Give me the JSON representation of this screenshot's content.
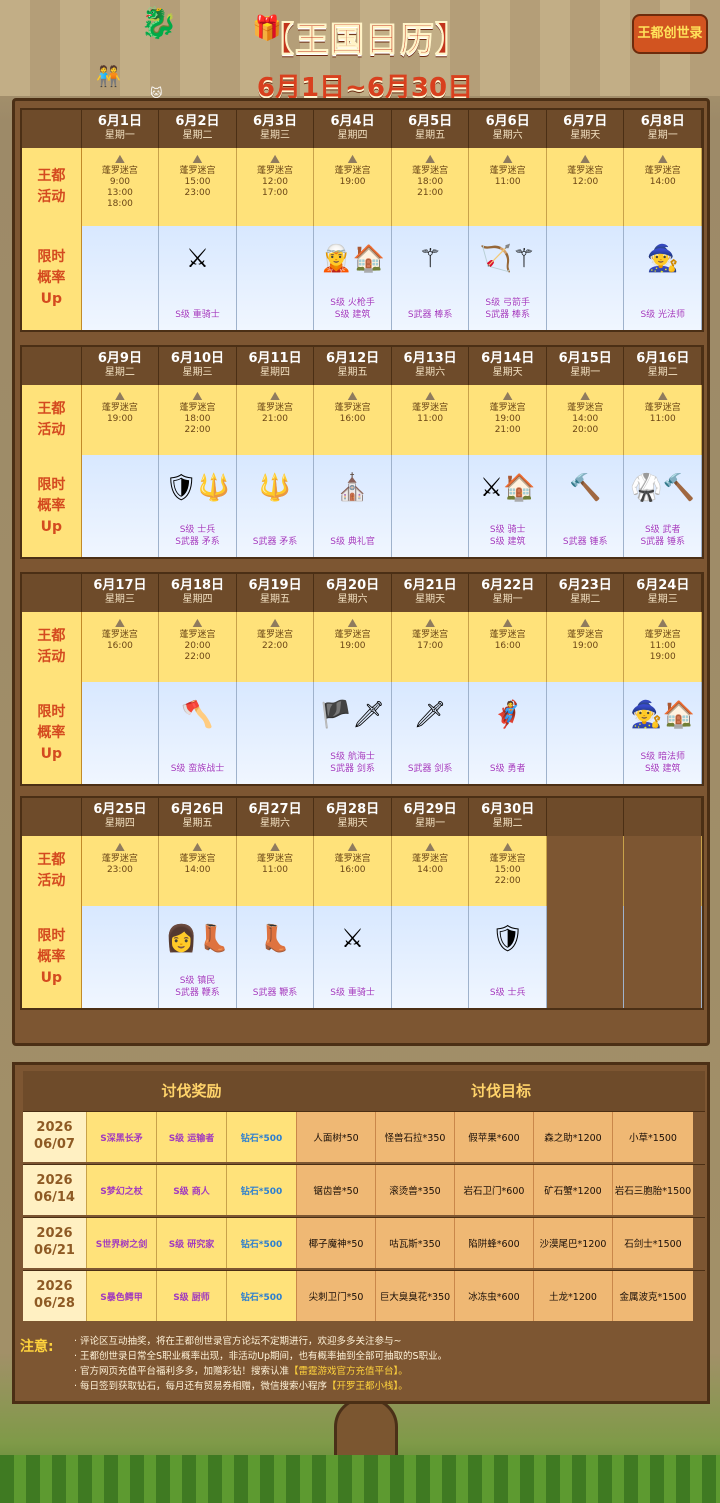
{
  "header": {
    "title": "【王国日历",
    "title_end": "】",
    "subtitle": "6月1日~6月30日",
    "logo": "王都创世录"
  },
  "labels": {
    "activity": [
      "王都",
      "活动"
    ],
    "rateup": [
      "限时",
      "概率",
      "Up"
    ]
  },
  "weeks": [
    {
      "days": [
        {
          "date": "6月1日",
          "weekday": "星期一",
          "activity": "蓬罗迷宫",
          "times": [
            "9:00",
            "13:00",
            "18:00"
          ],
          "sprites": [],
          "rates": []
        },
        {
          "date": "6月2日",
          "weekday": "星期二",
          "activity": "蓬罗迷宫",
          "times": [
            "15:00",
            "23:00"
          ],
          "sprites": [
            "⚔"
          ],
          "rates": [
            "S级 重骑士"
          ]
        },
        {
          "date": "6月3日",
          "weekday": "星期三",
          "activity": "蓬罗迷宫",
          "times": [
            "12:00",
            "17:00"
          ],
          "sprites": [],
          "rates": []
        },
        {
          "date": "6月4日",
          "weekday": "星期四",
          "activity": "蓬罗迷宫",
          "times": [
            "19:00"
          ],
          "sprites": [
            "🧝",
            "🏠"
          ],
          "rates": [
            "S级 火枪手",
            "S级 建筑"
          ]
        },
        {
          "date": "6月5日",
          "weekday": "星期五",
          "activity": "蓬罗迷宫",
          "times": [
            "18:00",
            "21:00"
          ],
          "sprites": [
            "⚚"
          ],
          "rates": [
            "S武器 棒系"
          ]
        },
        {
          "date": "6月6日",
          "weekday": "星期六",
          "activity": "蓬罗迷宫",
          "times": [
            "11:00"
          ],
          "sprites": [
            "🏹",
            "⚚"
          ],
          "rates": [
            "S级 弓箭手",
            "S武器 棒系"
          ]
        },
        {
          "date": "6月7日",
          "weekday": "星期天",
          "activity": "蓬罗迷宫",
          "times": [
            "12:00"
          ],
          "sprites": [],
          "rates": []
        },
        {
          "date": "6月8日",
          "weekday": "星期一",
          "activity": "蓬罗迷宫",
          "times": [
            "14:00"
          ],
          "sprites": [
            "🧙"
          ],
          "rates": [
            "S级 光法师"
          ]
        }
      ]
    },
    {
      "days": [
        {
          "date": "6月9日",
          "weekday": "星期二",
          "activity": "蓬罗迷宫",
          "times": [
            "19:00"
          ],
          "sprites": [],
          "rates": []
        },
        {
          "date": "6月10日",
          "weekday": "星期三",
          "activity": "蓬罗迷宫",
          "times": [
            "18:00",
            "22:00"
          ],
          "sprites": [
            "🛡",
            "🔱"
          ],
          "rates": [
            "S级 士兵",
            "S武器 矛系"
          ]
        },
        {
          "date": "6月11日",
          "weekday": "星期四",
          "activity": "蓬罗迷宫",
          "times": [
            "21:00"
          ],
          "sprites": [
            "🔱"
          ],
          "rates": [
            "S武器 矛系"
          ]
        },
        {
          "date": "6月12日",
          "weekday": "星期五",
          "activity": "蓬罗迷宫",
          "times": [
            "16:00"
          ],
          "sprites": [
            "⛪"
          ],
          "rates": [
            "S级 典礼官"
          ]
        },
        {
          "date": "6月13日",
          "weekday": "星期六",
          "activity": "蓬罗迷宫",
          "times": [
            "11:00"
          ],
          "sprites": [],
          "rates": []
        },
        {
          "date": "6月14日",
          "weekday": "星期天",
          "activity": "蓬罗迷宫",
          "times": [
            "19:00",
            "21:00"
          ],
          "sprites": [
            "⚔",
            "🏠"
          ],
          "rates": [
            "S级 骑士",
            "S级 建筑"
          ]
        },
        {
          "date": "6月15日",
          "weekday": "星期一",
          "activity": "蓬罗迷宫",
          "times": [
            "14:00",
            "20:00"
          ],
          "sprites": [
            "🔨"
          ],
          "rates": [
            "S武器 锤系"
          ]
        },
        {
          "date": "6月16日",
          "weekday": "星期二",
          "activity": "蓬罗迷宫",
          "times": [
            "11:00"
          ],
          "sprites": [
            "🥋",
            "🔨"
          ],
          "rates": [
            "S级 武者",
            "S武器 锤系"
          ]
        }
      ]
    },
    {
      "days": [
        {
          "date": "6月17日",
          "weekday": "星期三",
          "activity": "蓬罗迷宫",
          "times": [
            "16:00"
          ],
          "sprites": [],
          "rates": []
        },
        {
          "date": "6月18日",
          "weekday": "星期四",
          "activity": "蓬罗迷宫",
          "times": [
            "20:00",
            "22:00"
          ],
          "sprites": [
            "🪓"
          ],
          "rates": [
            "S级 蛮族战士"
          ]
        },
        {
          "date": "6月19日",
          "weekday": "星期五",
          "activity": "蓬罗迷宫",
          "times": [
            "22:00"
          ],
          "sprites": [],
          "rates": []
        },
        {
          "date": "6月20日",
          "weekday": "星期六",
          "activity": "蓬罗迷宫",
          "times": [
            "19:00"
          ],
          "sprites": [
            "🏴",
            "🗡"
          ],
          "rates": [
            "S级 航海士",
            "S武器 剑系"
          ]
        },
        {
          "date": "6月21日",
          "weekday": "星期天",
          "activity": "蓬罗迷宫",
          "times": [
            "17:00"
          ],
          "sprites": [
            "🗡"
          ],
          "rates": [
            "S武器 剑系"
          ]
        },
        {
          "date": "6月22日",
          "weekday": "星期一",
          "activity": "蓬罗迷宫",
          "times": [
            "16:00"
          ],
          "sprites": [
            "🦸"
          ],
          "rates": [
            "S级 勇者"
          ]
        },
        {
          "date": "6月23日",
          "weekday": "星期二",
          "activity": "蓬罗迷宫",
          "times": [
            "19:00"
          ],
          "sprites": [],
          "rates": []
        },
        {
          "date": "6月24日",
          "weekday": "星期三",
          "activity": "蓬罗迷宫",
          "times": [
            "11:00",
            "19:00"
          ],
          "sprites": [
            "🧙",
            "🏠"
          ],
          "rates": [
            "S级 暗法师",
            "S级 建筑"
          ]
        }
      ]
    },
    {
      "days": [
        {
          "date": "6月25日",
          "weekday": "星期四",
          "activity": "蓬罗迷宫",
          "times": [
            "23:00"
          ],
          "sprites": [],
          "rates": []
        },
        {
          "date": "6月26日",
          "weekday": "星期五",
          "activity": "蓬罗迷宫",
          "times": [
            "14:00"
          ],
          "sprites": [
            "👩",
            "👢"
          ],
          "rates": [
            "S级 镇民",
            "S武器 鞭系"
          ]
        },
        {
          "date": "6月27日",
          "weekday": "星期六",
          "activity": "蓬罗迷宫",
          "times": [
            "11:00"
          ],
          "sprites": [
            "👢"
          ],
          "rates": [
            "S武器 鞭系"
          ]
        },
        {
          "date": "6月28日",
          "weekday": "星期天",
          "activity": "蓬罗迷宫",
          "times": [
            "16:00"
          ],
          "sprites": [
            "⚔"
          ],
          "rates": [
            "S级 重骑士"
          ]
        },
        {
          "date": "6月29日",
          "weekday": "星期一",
          "activity": "蓬罗迷宫",
          "times": [
            "14:00"
          ],
          "sprites": [],
          "rates": []
        },
        {
          "date": "6月30日",
          "weekday": "星期二",
          "activity": "蓬罗迷宫",
          "times": [
            "15:00",
            "22:00"
          ],
          "sprites": [
            "🛡"
          ],
          "rates": [
            "S级 士兵"
          ]
        },
        null,
        null
      ]
    }
  ],
  "board": {
    "reward_header": "讨伐奖励",
    "target_header": "讨伐目标",
    "rows": [
      {
        "year": "2026",
        "date": "06/07",
        "rewards": [
          "S深黑长矛",
          "S级 运输者",
          "钻石*500"
        ],
        "targets": [
          "人面树*50",
          "怪兽石拉*350",
          "假苹果*600",
          "森之助*1200",
          "小草*1500"
        ]
      },
      {
        "year": "2026",
        "date": "06/14",
        "rewards": [
          "S梦幻之杖",
          "S级 商人",
          "钻石*500"
        ],
        "targets": [
          "锯齿兽*50",
          "滚烫兽*350",
          "岩石卫门*600",
          "矿石蟹*1200",
          "岩石三胞胎*1500"
        ]
      },
      {
        "year": "2026",
        "date": "06/21",
        "rewards": [
          "S世界树之剑",
          "S级 研究家",
          "钻石*500"
        ],
        "targets": [
          "椰子魔神*50",
          "咕瓦斯*350",
          "陷阱蜂*600",
          "沙漠尾巴*1200",
          "石剑士*1500"
        ]
      },
      {
        "year": "2026",
        "date": "06/28",
        "rewards": [
          "S暴色鳄甲",
          "S级 厨师",
          "钻石*500"
        ],
        "targets": [
          "尖刺卫门*50",
          "巨大臭臭花*350",
          "冰冻虫*600",
          "土龙*1200",
          "金属波克*1500"
        ]
      }
    ]
  },
  "notes": {
    "label": "注意:",
    "items": [
      {
        "text": "· 评论区互动抽奖，将在王都创世录官方论坛不定期进行，欢迎多多关注参与~",
        "hl": ""
      },
      {
        "text": "· 王都创世录日常全S职业概率出现，非活动Up期间，也有概率抽到全部可抽取的S职业。",
        "hl": ""
      },
      {
        "text": "· 官方网页充值平台福利多多，加赠彩钻！搜索认准",
        "hl": "【雷霆游戏官方充值平台】。"
      },
      {
        "text": "· 每日签到获取钻石，每月还有贸易券相赠，微信搜索小程序",
        "hl": "【开罗王都小栈】。"
      }
    ]
  },
  "colors": {
    "accent": "#d44a1f",
    "rate_text": "#a23abf",
    "diamond": "#2d7fd0",
    "panel": "#7d5632"
  }
}
